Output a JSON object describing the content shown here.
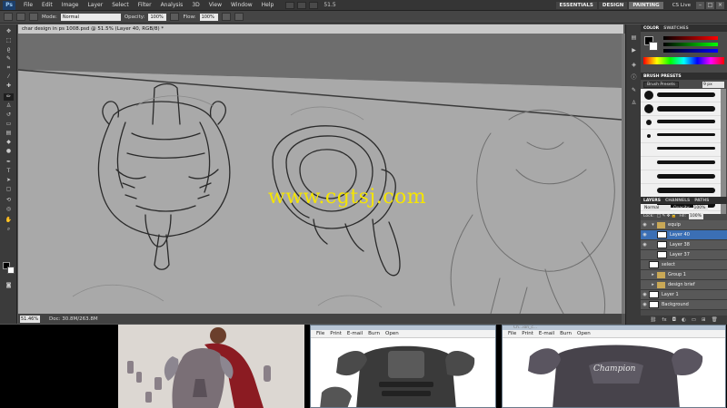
{
  "app": {
    "logo": "Ps",
    "menus": [
      "File",
      "Edit",
      "Image",
      "Layer",
      "Select",
      "Filter",
      "Analysis",
      "3D",
      "View",
      "Window",
      "Help"
    ],
    "zoom": "51.5",
    "workspaces": [
      "ESSENTIALS",
      "DESIGN",
      "PAINTING"
    ],
    "active_workspace": "PAINTING",
    "cs_live": "CS Live"
  },
  "options": {
    "mode_label": "Mode:",
    "mode_value": "Normal",
    "opacity_label": "Opacity:",
    "opacity_value": "100%",
    "flow_label": "Flow:",
    "flow_value": "100%"
  },
  "document": {
    "tab_title": "char design in ps 1008.psd @ 51.5% (Layer 40, RGB/8) *",
    "zoom_status": "51.46%",
    "doc_size": "Doc: 30.8M/263.8M"
  },
  "watermark": "www.cgtsj.com",
  "color_panel": {
    "tabs": [
      "COLOR",
      "SWATCHES"
    ],
    "fg_color": "#000000",
    "bg_color": "#ffffff"
  },
  "brush_presets": {
    "tab": "BRUSH PRESETS",
    "button": "Brush Presets",
    "size": "9 px",
    "numbers": [
      "",
      "",
      "",
      "",
      "",
      "",
      "",
      "",
      ""
    ]
  },
  "layers_panel": {
    "tabs": [
      "LAYERS",
      "CHANNELS",
      "PATHS"
    ],
    "blend_mode": "Normal",
    "opacity_label": "Opacity:",
    "opacity_value": "100%",
    "lock_label": "Lock:",
    "fill_label": "Fill:",
    "fill_value": "100%",
    "layers": [
      {
        "name": "equip",
        "type": "group"
      },
      {
        "name": "Layer 40",
        "type": "layer",
        "selected": true
      },
      {
        "name": "Layer 38",
        "type": "layer"
      },
      {
        "name": "Layer 37",
        "type": "layer"
      },
      {
        "name": "select",
        "type": "layer"
      },
      {
        "name": "Group 1",
        "type": "group"
      },
      {
        "name": "design brief",
        "type": "group"
      },
      {
        "name": "Layer 1",
        "type": "layer"
      },
      {
        "name": "Background",
        "type": "layer"
      }
    ],
    "footer_icons": [
      "link-icon",
      "fx-icon",
      "mask-icon",
      "adjust-icon",
      "folder-icon",
      "new-layer-icon",
      "trash-icon"
    ]
  },
  "ref_windows": [
    {
      "menus": [
        "File",
        "Print",
        "E-mail",
        "Burn",
        "Open"
      ]
    },
    {
      "url": "Ch...ion_c...",
      "menus": [
        "File",
        "Print",
        "E-mail",
        "Burn",
        "Open"
      ],
      "brand": "Champion"
    }
  ]
}
